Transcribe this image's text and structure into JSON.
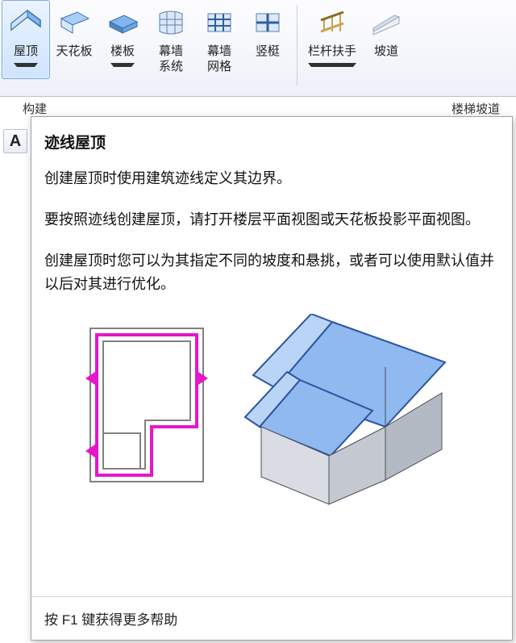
{
  "ribbon": {
    "items": [
      {
        "label": "屋顶",
        "dropdown": true,
        "selected": true
      },
      {
        "label": "天花板",
        "dropdown": false,
        "selected": false
      },
      {
        "label": "楼板",
        "dropdown": true,
        "selected": false
      },
      {
        "label": "幕墙\n系统",
        "dropdown": false,
        "selected": false
      },
      {
        "label": "幕墙\n网格",
        "dropdown": false,
        "selected": false
      },
      {
        "label": "竖梃",
        "dropdown": false,
        "selected": false
      },
      {
        "label": "栏杆扶手",
        "dropdown": true,
        "selected": false
      },
      {
        "label": "坡道",
        "dropdown": false,
        "selected": false
      }
    ],
    "panel_left": "构建",
    "panel_right": "楼梯坡道"
  },
  "side_button": "A",
  "tooltip": {
    "title": "迹线屋顶",
    "p1": "创建屋顶时使用建筑迹线定义其边界。",
    "p2": "要按照迹线创建屋顶，请打开楼层平面视图或天花板投影平面视图。",
    "p3": "创建屋顶时您可以为其指定不同的坡度和悬挑，或者可以使用默认值并以后对其进行优化。",
    "footer": "按 F1 键获得更多帮助"
  }
}
